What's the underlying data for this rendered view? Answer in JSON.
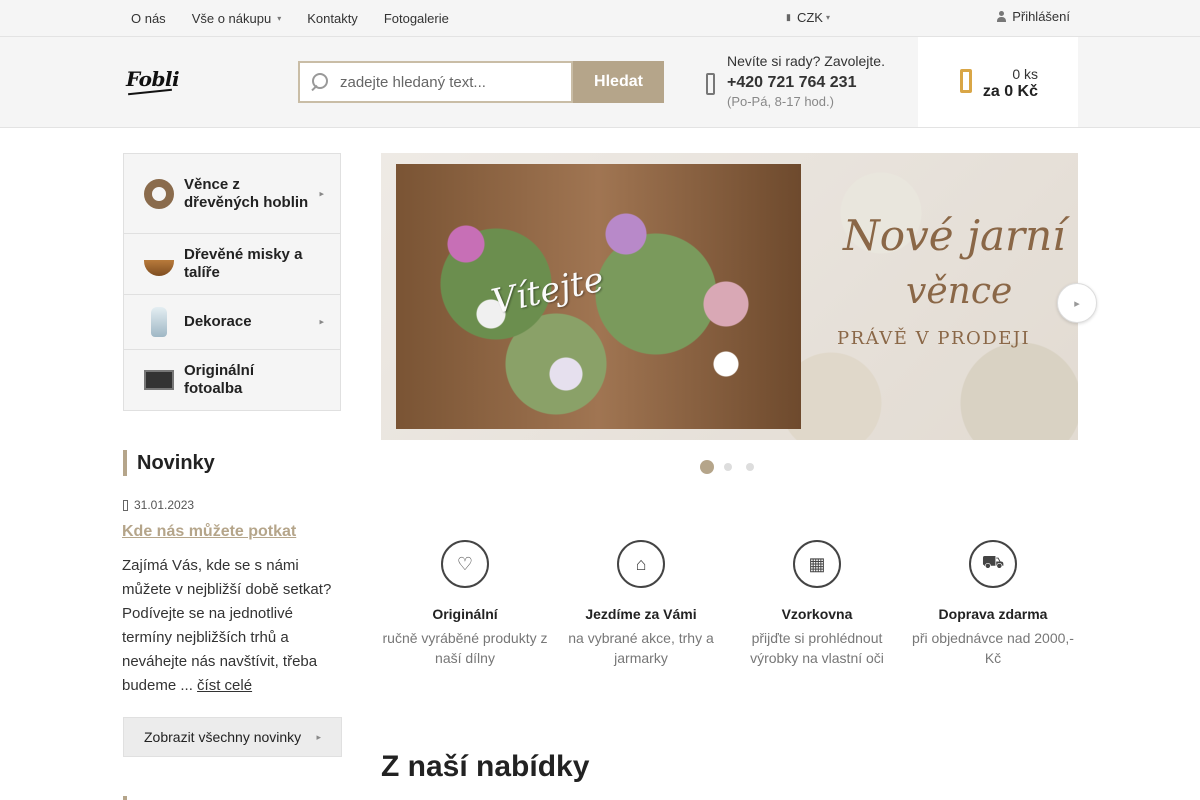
{
  "topnav": {
    "items": [
      {
        "label": "O nás"
      },
      {
        "label": "Vše o nákupu",
        "caret": "▾"
      },
      {
        "label": "Kontakty"
      },
      {
        "label": "Fotogalerie"
      }
    ],
    "currency": "CZK",
    "login": "Přihlášení"
  },
  "header": {
    "logo": "Fobli",
    "search": {
      "placeholder": "zadejte hledaný text...",
      "button": "Hledat"
    },
    "contact": {
      "question": "Nevíte si rady? Zavolejte.",
      "phone": "+420 721 764 231",
      "hours": "(Po-Pá, 8-17 hod.)"
    },
    "cart": {
      "count": "0 ks",
      "total": "za 0 Kč"
    }
  },
  "categories": [
    {
      "label": "Věnce z dřevěných hoblin",
      "has_sub": true
    },
    {
      "label": "Dřevěné misky a talíře",
      "has_sub": false
    },
    {
      "label": "Dekorace",
      "has_sub": true
    },
    {
      "label": "Originální fotoalba",
      "has_sub": false
    }
  ],
  "news": {
    "heading": "Novinky",
    "date": "31.01.2023",
    "title": "Kde nás můžete potkat",
    "text": "Zajímá Vás, kde se s námi můžete v nejbližší době setkat? Podívejte se na jednotlivé termíny nejbližších trhů a neváhejte nás navštívit, třeba budeme ... ",
    "read_more": "číst celé",
    "all_button": "Zobrazit všechny novinky"
  },
  "banner": {
    "welcome": "Vítejte",
    "line1": "Nové jarní",
    "line2": "věnce",
    "line3": "PRÁVĚ V PRODEJI",
    "slides": 3,
    "active_slide": 1
  },
  "benefits": [
    {
      "icon": "handmade-heart-icon",
      "glyph": "♡",
      "title": "Originální",
      "text": "ručně vyráběné produkty z naší dílny"
    },
    {
      "icon": "market-stall-icon",
      "glyph": "⌂",
      "title": "Jezdíme za Vámi",
      "text": "na vybrané akce, trhy a jarmarky"
    },
    {
      "icon": "shop-icon",
      "glyph": "▦",
      "title": "Vzorkovna",
      "text": "přijďte si prohlédnout výrobky na vlastní oči"
    },
    {
      "icon": "delivery-truck-icon",
      "glyph": "⛟",
      "title": "Doprava zdarma",
      "text": "při objednávce nad 2000,- Kč"
    }
  ],
  "offer_heading": "Z naší nabídky",
  "colors": {
    "accent": "#b5a58a",
    "cart_icon": "#d9a646"
  }
}
